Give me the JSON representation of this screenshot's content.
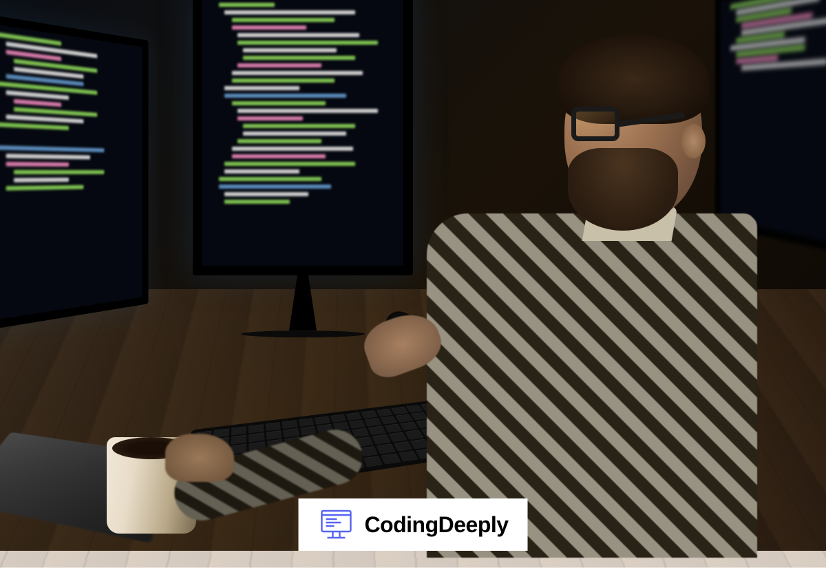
{
  "brand": {
    "name": "CodingDeeply",
    "icon_name": "computer-code-icon",
    "icon_color": "#5864f2"
  },
  "scene": {
    "description": "Bearded man with glasses in plaid shirt coding at night with dual monitors, keyboard, mouse, laptop and coffee mug on wooden desk"
  }
}
